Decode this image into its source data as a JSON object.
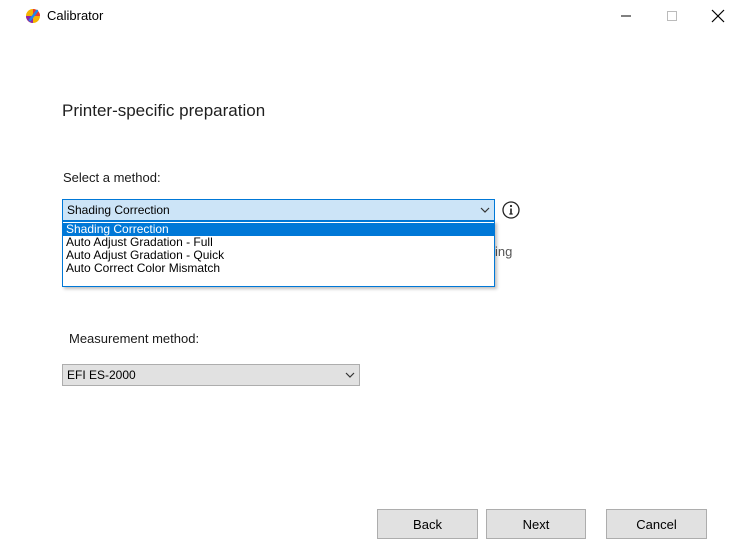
{
  "window": {
    "title": "Calibrator",
    "app_icon": "calibrator-app-icon",
    "controls": [
      "minimize-icon",
      "maximize-icon",
      "close-icon"
    ]
  },
  "page": {
    "heading": "Printer-specific preparation"
  },
  "method_select": {
    "label": "Select a method:",
    "selected": "Shading Correction",
    "options": [
      "Shading Correction",
      "Auto Adjust Gradation - Full",
      "Auto Adjust Gradation - Quick",
      "Auto Correct Color Mismatch"
    ],
    "info_icon": "info-icon",
    "obscured_text_fragment": "ing"
  },
  "measurement_select": {
    "label": "Measurement method:",
    "selected": "EFI ES-2000"
  },
  "buttons": {
    "back": "Back",
    "next": "Next",
    "cancel": "Cancel"
  },
  "colors": {
    "selection_blue": "#0078d7",
    "focused_combo_bg": "#cce4f7",
    "button_bg": "#e1e1e1"
  }
}
